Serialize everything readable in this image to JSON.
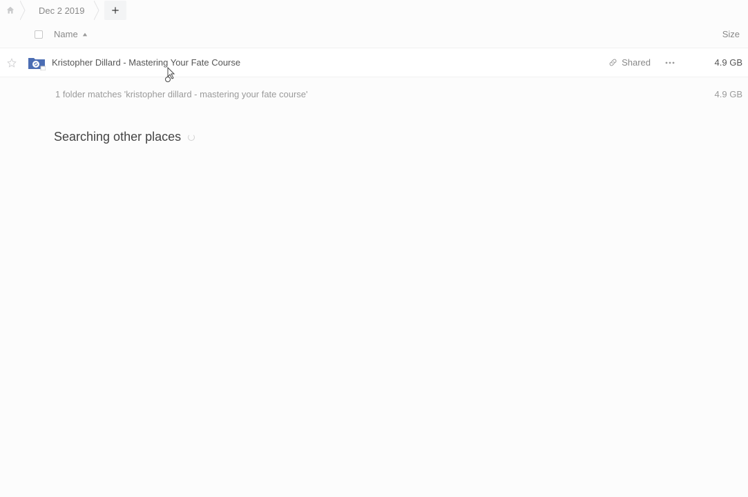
{
  "breadcrumb": {
    "current": "Dec 2 2019"
  },
  "columns": {
    "name": "Name",
    "size": "Size"
  },
  "rows": [
    {
      "name": "Kristopher Dillard - Mastering Your Fate Course",
      "shared_label": "Shared",
      "size": "4.9 GB"
    }
  ],
  "summary": {
    "text": "1 folder matches 'kristopher dillard - mastering your fate course'",
    "size": "4.9 GB"
  },
  "searching": {
    "heading": "Searching other places"
  }
}
